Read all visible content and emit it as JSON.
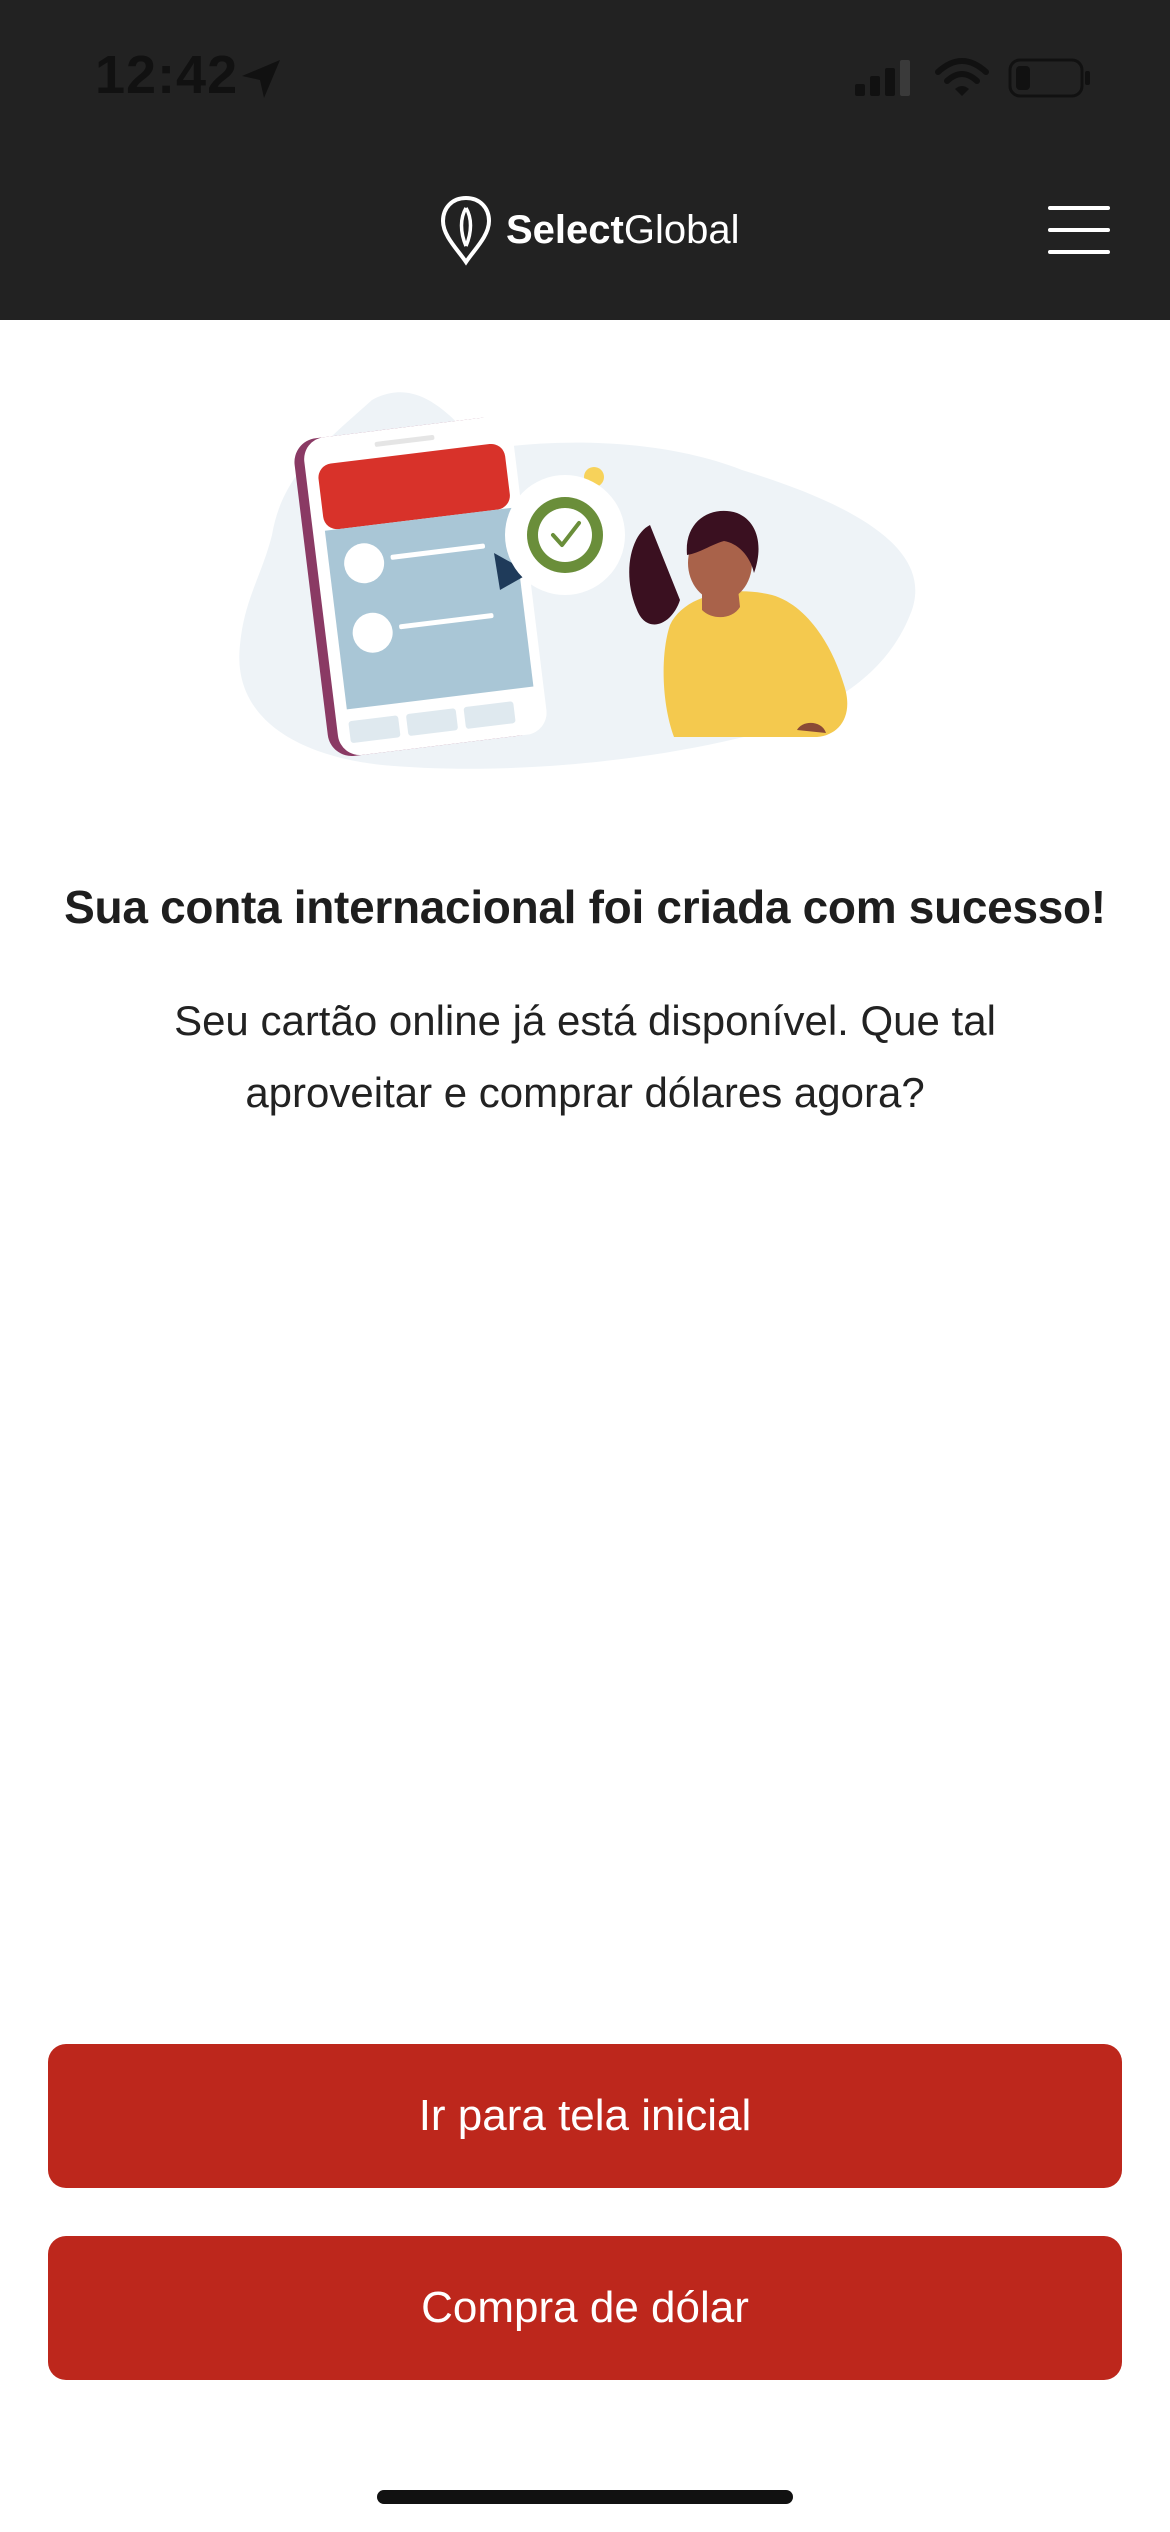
{
  "status_bar": {
    "time": "12:42",
    "icons": [
      "location-arrow-icon",
      "cellular-signal-icon",
      "wifi-icon",
      "battery-low-icon"
    ]
  },
  "header": {
    "brand_bold": "Select",
    "brand_regular": "Global",
    "menu_icon": "hamburger-menu-icon"
  },
  "illustration": {
    "description_icon": "phone-success-illustration"
  },
  "content": {
    "headline": "Sua conta internacional foi criada com sucesso!",
    "subtext": "Seu cartão online já está disponível.  Que tal aproveitar e comprar dólares agora?"
  },
  "actions": {
    "home_label": "Ir para tela inicial",
    "buy_label": "Compra de dólar"
  },
  "colors": {
    "header_bg": "#222222",
    "primary_button": "#bd271c",
    "accent_yellow": "#f7d25a",
    "accent_green": "#6a8e3a"
  }
}
